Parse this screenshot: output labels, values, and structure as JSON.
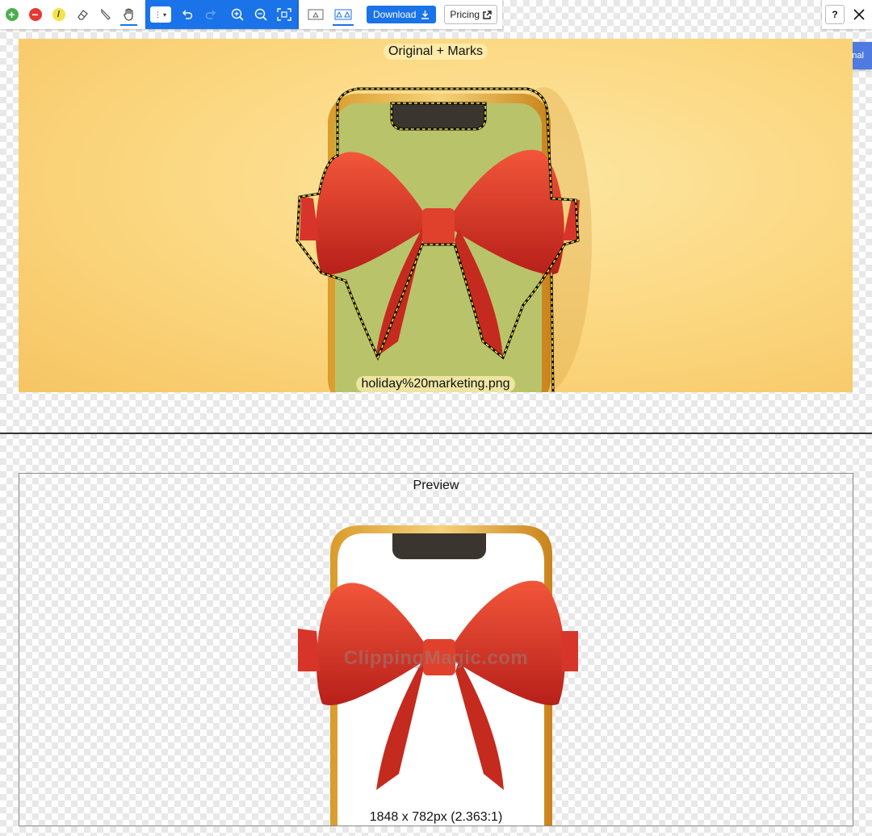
{
  "toolbar": {
    "download_label": "Download",
    "pricing_label": "Pricing",
    "help_label": "?"
  },
  "side_tab": {
    "original_label": "Original"
  },
  "top_panel": {
    "title": "Original + Marks",
    "filename": "holiday%20marketing.png"
  },
  "bottom_panel": {
    "title": "Preview",
    "watermark": "ClippingMagic.com",
    "dimensions": "1848 x 782px (2.363:1)"
  },
  "colors": {
    "accent": "#1a73e8",
    "keep_green": "#4caf50",
    "remove_red": "#e53935",
    "highlighter_yellow": "#f5e14a",
    "original_tab": "#4f7be0"
  }
}
